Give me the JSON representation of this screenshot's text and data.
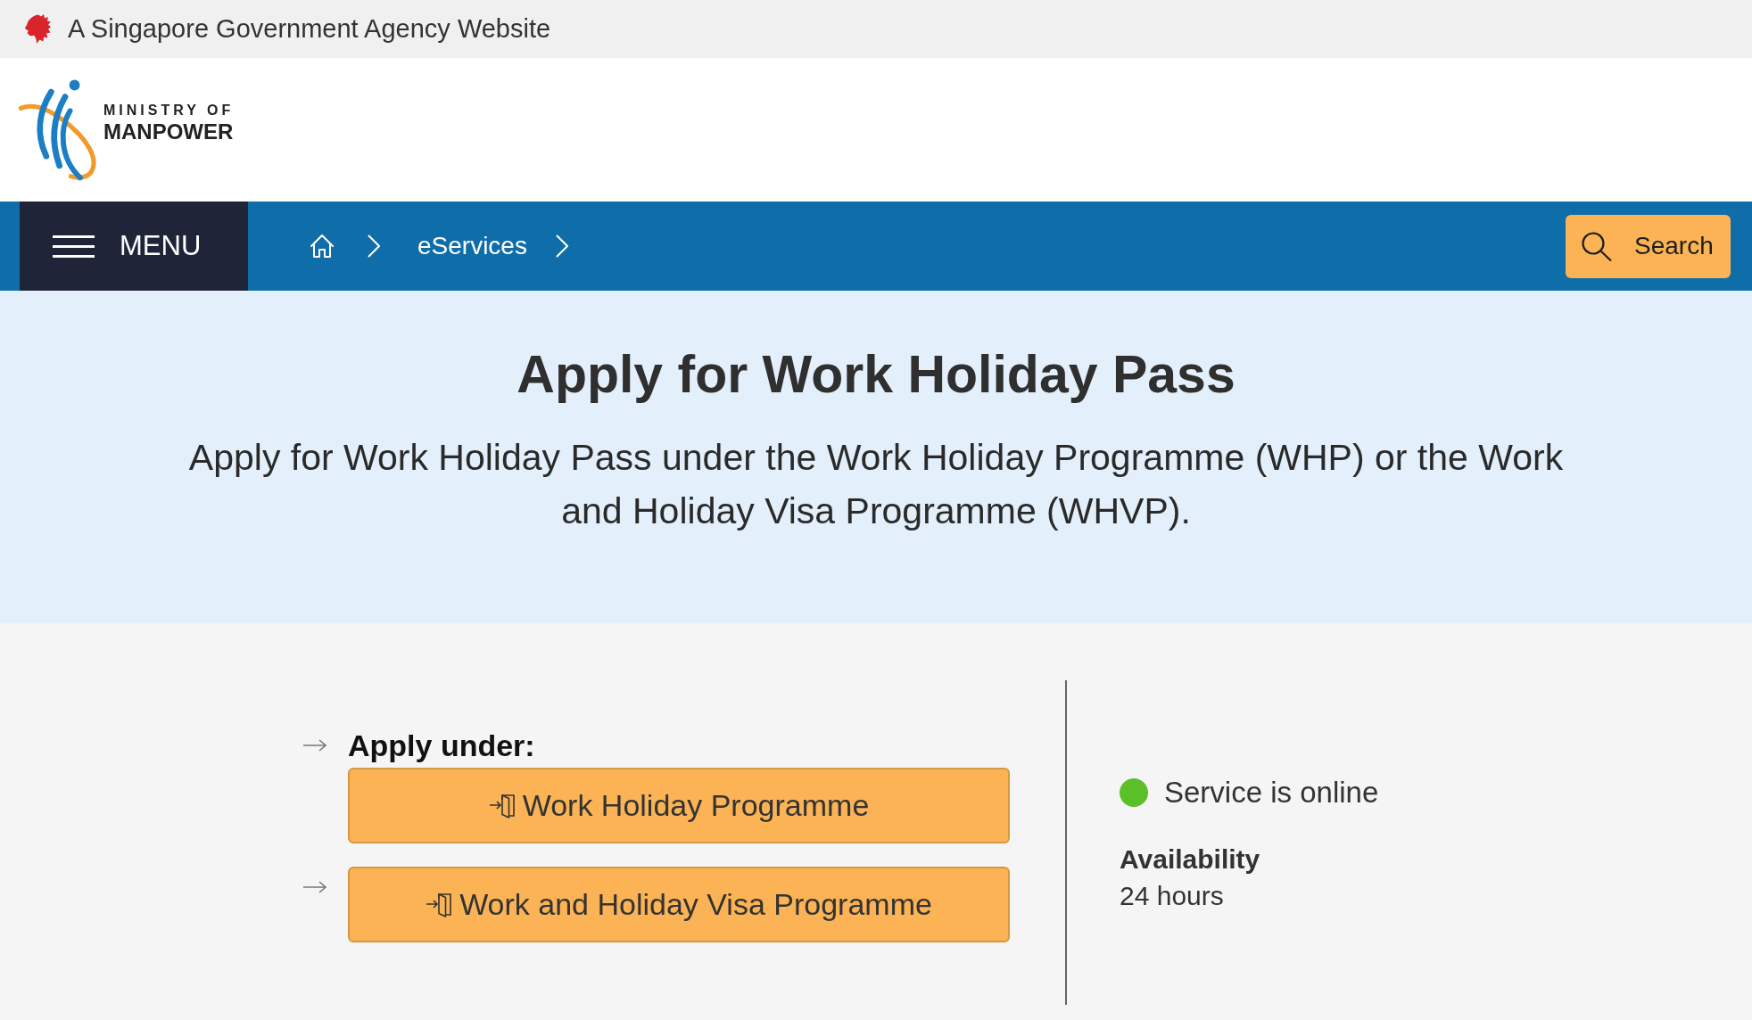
{
  "gov_banner": {
    "text": "A Singapore Government Agency Website"
  },
  "logo": {
    "line_1": "MINISTRY OF",
    "line_2": "MANPOWER"
  },
  "nav": {
    "menu_label": "MENU",
    "breadcrumbs": [
      {
        "kind": "home"
      },
      {
        "kind": "link",
        "label": "eServices"
      }
    ],
    "search_label": "Search"
  },
  "hero": {
    "title": "Apply for Work Holiday Pass",
    "subtitle": "Apply for Work Holiday Pass under the Work Holiday Programme (WHP) or the Work and Holiday Visa Programme (WHVP)."
  },
  "apply": [
    {
      "heading": "Apply under:",
      "button": "Work Holiday Programme"
    },
    {
      "button": "Work and Holiday Visa Programme"
    }
  ],
  "status": {
    "online": true,
    "label": "Service is online"
  },
  "availability": {
    "label": "Availability",
    "value": "24 hours"
  }
}
